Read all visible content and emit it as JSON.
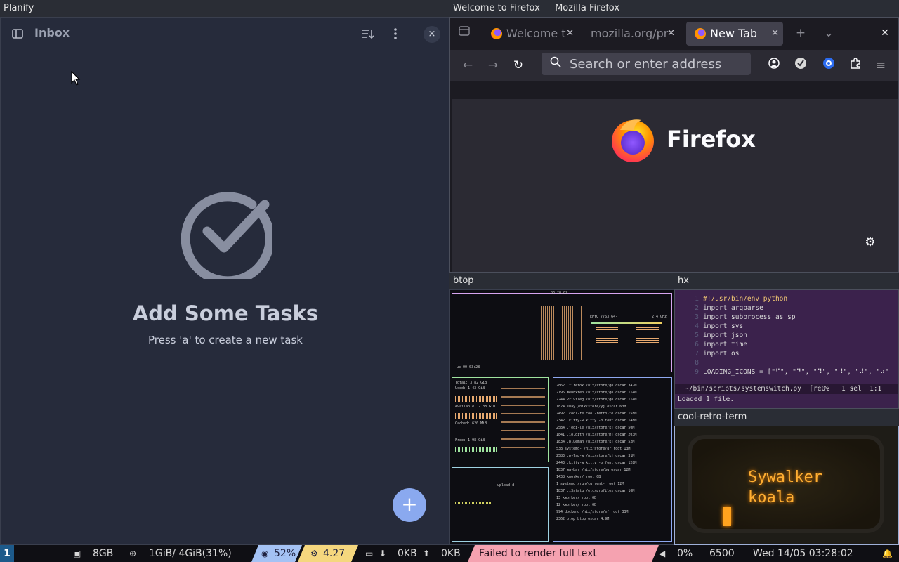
{
  "planify": {
    "window_title": "Planify",
    "header_title": "Inbox",
    "empty_title": "Add Some Tasks",
    "empty_subtitle": "Press 'a' to create a new task",
    "close_glyph": "×",
    "fab_glyph": "+"
  },
  "firefox": {
    "window_title": "Welcome to Firefox — Mozilla Firefox",
    "tabs": [
      {
        "label": "Welcome t"
      },
      {
        "label": "mozilla.org/pr"
      },
      {
        "label": "New Tab"
      }
    ],
    "search_placeholder": "Search or enter address",
    "logo_text": "Firefox"
  },
  "btop": {
    "window_title": "btop",
    "cpu_name": "EPYC 7763 64-",
    "cpu_freq": "2.4 GHz",
    "clock": "03:28:02",
    "uptime": "up 00:03:28",
    "mem_total": "Total:   3.82 GiB",
    "mem_used": "Used:    1.43 GiB",
    "mem_available": "Available: 2.38 GiB",
    "mem_cached": "Cached:   620 MiB",
    "mem_free": "Free:    1.98 GiB",
    "net_upload": "upload d",
    "processes": [
      "2862 .firefox /nix/store/g8 oscar 342M",
      "2195 WebExten /nix/store/g8 oscar 114M",
      "2244 Privileg /nix/store/g8 oscar 114M",
      "1824 sway     /nix/store/yj oscar  63M",
      "2492 .cool-re cool-retro-te oscar 158M",
      "2342 .kitty-w kitty -o font oscar 148M",
      "2584 .jedi-le /nix/store/kj oscar  50M",
      "1841 .io.gith /nix/store/mj oscar 203M",
      "1834 .blueman /nix/store/kj oscar  52M",
      "538  systemd- /nix/store/8r root   13M",
      "2583 .pylsp-w /nix/store/kj oscar  31M",
      "2443 .kitty-w kitty -o font oscar 128M",
      "1837 waybar   /nix/store/bq oscar  12M",
      "1438 kworker/                root    0B",
      "1    systemd  /run/current- root   12M",
      "1837 .i3statu /etc/profiles oscar  10M",
      "13   kworker/                root    0B",
      "12   kworker/                root    0B",
      "994  dockend  /nix/store/mf root   33M",
      "2362 btop     btop          oscar 4.9M"
    ]
  },
  "hx": {
    "window_title": "hx",
    "lines": [
      {
        "n": "1",
        "code": "#!/usr/bin/env python"
      },
      {
        "n": "2",
        "code": "import argparse"
      },
      {
        "n": "3",
        "code": "import subprocess as sp"
      },
      {
        "n": "4",
        "code": "import sys"
      },
      {
        "n": "5",
        "code": "import json"
      },
      {
        "n": "6",
        "code": "import time"
      },
      {
        "n": "7",
        "code": "import os"
      },
      {
        "n": "8",
        "code": ""
      },
      {
        "n": "9",
        "code": "LOADING_ICONS = [\"⠋\", \"⠙\", \"⠹\", \"⠸\", \"⠼\", \"⠴\""
      }
    ],
    "status_line": "~/bin/scripts/systemswitch.py  [re0%   1 sel  1:1",
    "message": "Loaded 1 file."
  },
  "crt": {
    "window_title": "cool-retro-term",
    "text": "Sywalker\nkoala"
  },
  "statusbar": {
    "workspace": "1",
    "disk": "8GB",
    "memory": "1GiB/ 4GiB(31%)",
    "cpu": "52%",
    "load": "4.27",
    "net_down": "0KB",
    "net_up": "0KB",
    "error": "Failed to render full text",
    "volume": "0%",
    "temperature": "6500",
    "datetime": "Wed 14/05 03:28:02"
  },
  "colors": {
    "planify_bg": "#262b3b",
    "fab": "#8aa9ef",
    "btop_cpu_box": "#d6a4f0",
    "btop_mem_box": "#9fe39f",
    "btop_proc_box": "#8ea8f0",
    "crt_amber": "#ffae32"
  }
}
